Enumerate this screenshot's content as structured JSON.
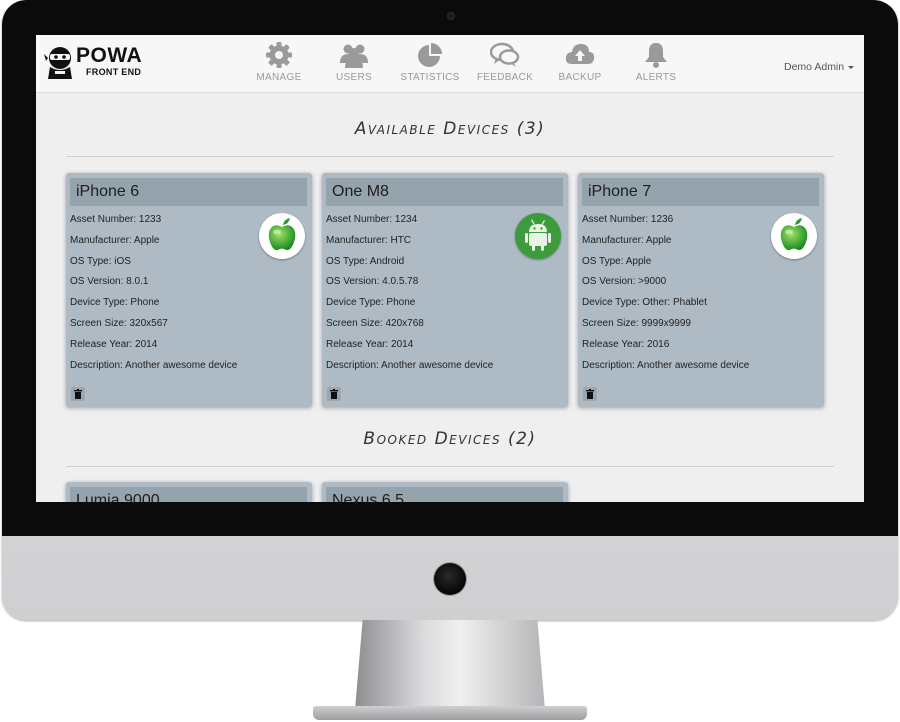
{
  "brand": {
    "top": "POWA",
    "bottom": "FRONT END"
  },
  "nav": [
    {
      "label": "MANAGE",
      "icon": "gear-icon"
    },
    {
      "label": "USERS",
      "icon": "users-icon"
    },
    {
      "label": "STATISTICS",
      "icon": "pie-chart-icon"
    },
    {
      "label": "FEEDBACK",
      "icon": "chat-bubbles-icon"
    },
    {
      "label": "BACKUP",
      "icon": "cloud-upload-icon"
    },
    {
      "label": "ALERTS",
      "icon": "bell-icon"
    }
  ],
  "user_menu": {
    "label": "Demo Admin"
  },
  "available": {
    "title": "Available Devices (3)",
    "devices": [
      {
        "name": "iPhone 6",
        "os_icon": "apple-icon",
        "fields": [
          "Asset Number: 1233",
          "Manufacturer: Apple",
          "OS Type: iOS",
          "OS Version: 8.0.1",
          "Device Type: Phone",
          "Screen Size: 320x567",
          "Release Year: 2014",
          "Description: Another awesome device"
        ]
      },
      {
        "name": "One M8",
        "os_icon": "android-icon",
        "fields": [
          "Asset Number: 1234",
          "Manufacturer: HTC",
          "OS Type: Android",
          "OS Version: 4.0.5.78",
          "Device Type: Phone",
          "Screen Size: 420x768",
          "Release Year: 2014",
          "Description: Another awesome device"
        ]
      },
      {
        "name": "iPhone 7",
        "os_icon": "apple-icon",
        "fields": [
          "Asset Number: 1236",
          "Manufacturer: Apple",
          "OS Type: Apple",
          "OS Version: >9000",
          "Device Type: Other: Phablet",
          "Screen Size: 9999x9999",
          "Release Year: 2016",
          "Description: Another awesome device"
        ]
      }
    ]
  },
  "booked": {
    "title": "Booked Devices (2)",
    "devices": [
      {
        "name": "Lumia 9000"
      },
      {
        "name": "Nexus 6.5"
      }
    ]
  },
  "colors": {
    "card_bg": "#aebbc4",
    "card_header": "#95a3ad",
    "apple_green": "#3bb03b",
    "android_green": "#3d9b3d"
  }
}
